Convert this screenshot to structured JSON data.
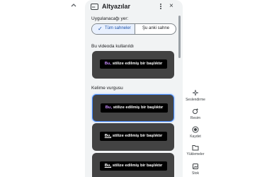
{
  "panel": {
    "title": "Altyazılar",
    "close_glyph": "×",
    "cc_label": "cc"
  },
  "apply": {
    "label": "Uygulanacağı yer:",
    "option_all": "Tüm sahneler",
    "option_current": "Şu anki sahne",
    "selected": "option_all"
  },
  "in_video": {
    "label": "Bu videoda kullanıldı"
  },
  "word_highlight": {
    "label": "Kelime vurgusu"
  },
  "caption_cards": [
    {
      "prefix": "Bu,",
      "rest": " stilize edilmiş bir başlıktır",
      "style": "purple-highlight"
    },
    {
      "prefix": "Bu,",
      "rest": " stilize edilmiş bir başlıktır",
      "style": "purple-highlight",
      "selected": true
    },
    {
      "prefix": "Bu,",
      "rest": " stilize edilmiş bir başlıktır",
      "style": "underline"
    },
    {
      "prefix": "Bu,",
      "rest": " stilize edilmiş bir başlıktır",
      "style": "underline"
    }
  ],
  "rail": {
    "items": [
      {
        "label": "Seslendirme",
        "icon": "sparkle-mic-icon"
      },
      {
        "label": "Resim",
        "icon": "sparkle-image-icon"
      },
      {
        "label": "Kaydet",
        "icon": "record-icon"
      },
      {
        "label": "Yüklemeler",
        "icon": "folder-icon"
      },
      {
        "label": "Stok",
        "icon": "stock-media-icon"
      }
    ]
  },
  "colors": {
    "panel_bg": "#f1f3f4",
    "card_bg": "#434343",
    "accent": "#1a73e8",
    "highlight_word": "#c58af9"
  }
}
